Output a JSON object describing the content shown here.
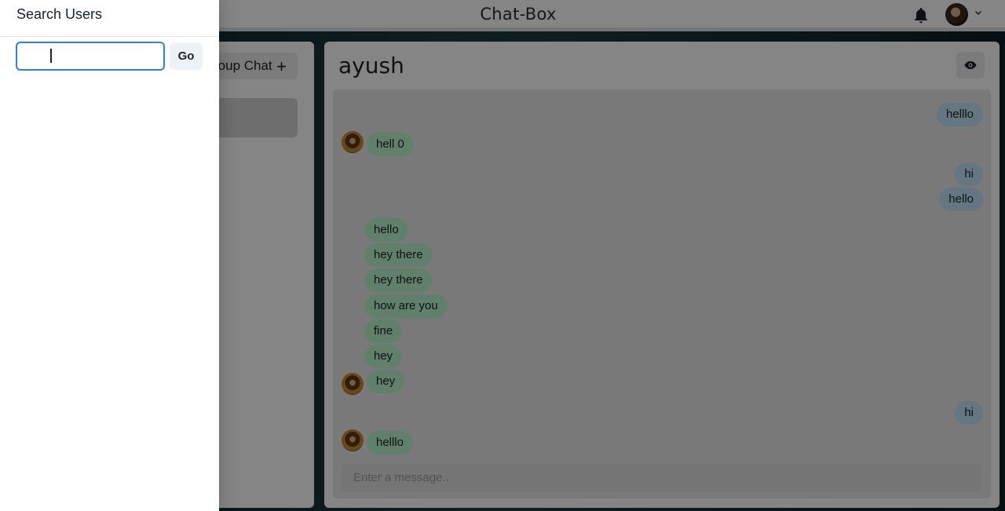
{
  "header": {
    "app_title": "Chat-Box",
    "icons": [
      "bell-icon",
      "avatar",
      "chevron-down-icon"
    ]
  },
  "sidebar": {
    "new_group_label": "roup Chat",
    "new_group_icon": "plus-icon"
  },
  "chat": {
    "name": "ayush",
    "profile_icon": "eye-icon",
    "input_placeholder": "Enter a message..",
    "messages": [
      {
        "text": "helllo",
        "from": "me"
      },
      {
        "text": "hell 0",
        "from": "them"
      },
      {
        "text": "hi",
        "from": "me"
      },
      {
        "text": "hello",
        "from": "me"
      },
      {
        "text": "hello",
        "from": "them"
      },
      {
        "text": "hey there",
        "from": "them"
      },
      {
        "text": "hey there",
        "from": "them"
      },
      {
        "text": "how are you",
        "from": "them"
      },
      {
        "text": "fine",
        "from": "them"
      },
      {
        "text": "hey",
        "from": "them"
      },
      {
        "text": "hey",
        "from": "them"
      },
      {
        "text": "hi",
        "from": "me"
      },
      {
        "text": "helllo",
        "from": "them"
      }
    ]
  },
  "drawer": {
    "title": "Search Users",
    "search_value": "",
    "go_label": "Go"
  },
  "colors": {
    "my_bubble": "#bee3f8",
    "their_bubble": "#b9f5d0",
    "focus_border": "#3182ce"
  }
}
